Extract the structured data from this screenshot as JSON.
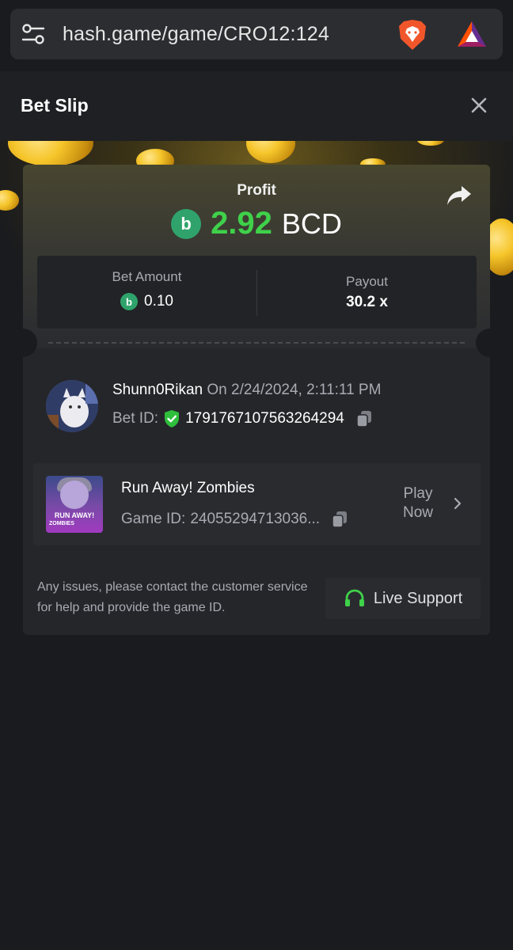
{
  "browser": {
    "url": "hash.game/game/CRO12:124"
  },
  "slip": {
    "title": "Bet Slip"
  },
  "profit": {
    "label": "Profit",
    "amount": "2.92",
    "currency": "BCD",
    "amount_color": "#3fd14a"
  },
  "stats": {
    "bet_amount_label": "Bet Amount",
    "bet_amount_value": "0.10",
    "payout_label": "Payout",
    "payout_value": "30.2 x"
  },
  "user": {
    "name": "Shunn0Rikan",
    "date": "On 2/24/2024, 2:11:11 PM",
    "bet_id_label": "Bet ID:",
    "bet_id": "1791767107563264294"
  },
  "game": {
    "name": "Run Away! Zombies",
    "thumb_line1": "RUN AWAY!",
    "thumb_line2": "ZOMBIES",
    "game_id_label": "Game ID:",
    "game_id": "24055294713036...",
    "play_label": "Play Now"
  },
  "support": {
    "text": "Any issues, please contact the customer service for help and provide the game ID.",
    "button_label": "Live Support"
  },
  "colors": {
    "accent_green": "#3fd14a",
    "coin_green": "#2fa36b",
    "background": "#1a1b1e",
    "card": "#25262a"
  }
}
